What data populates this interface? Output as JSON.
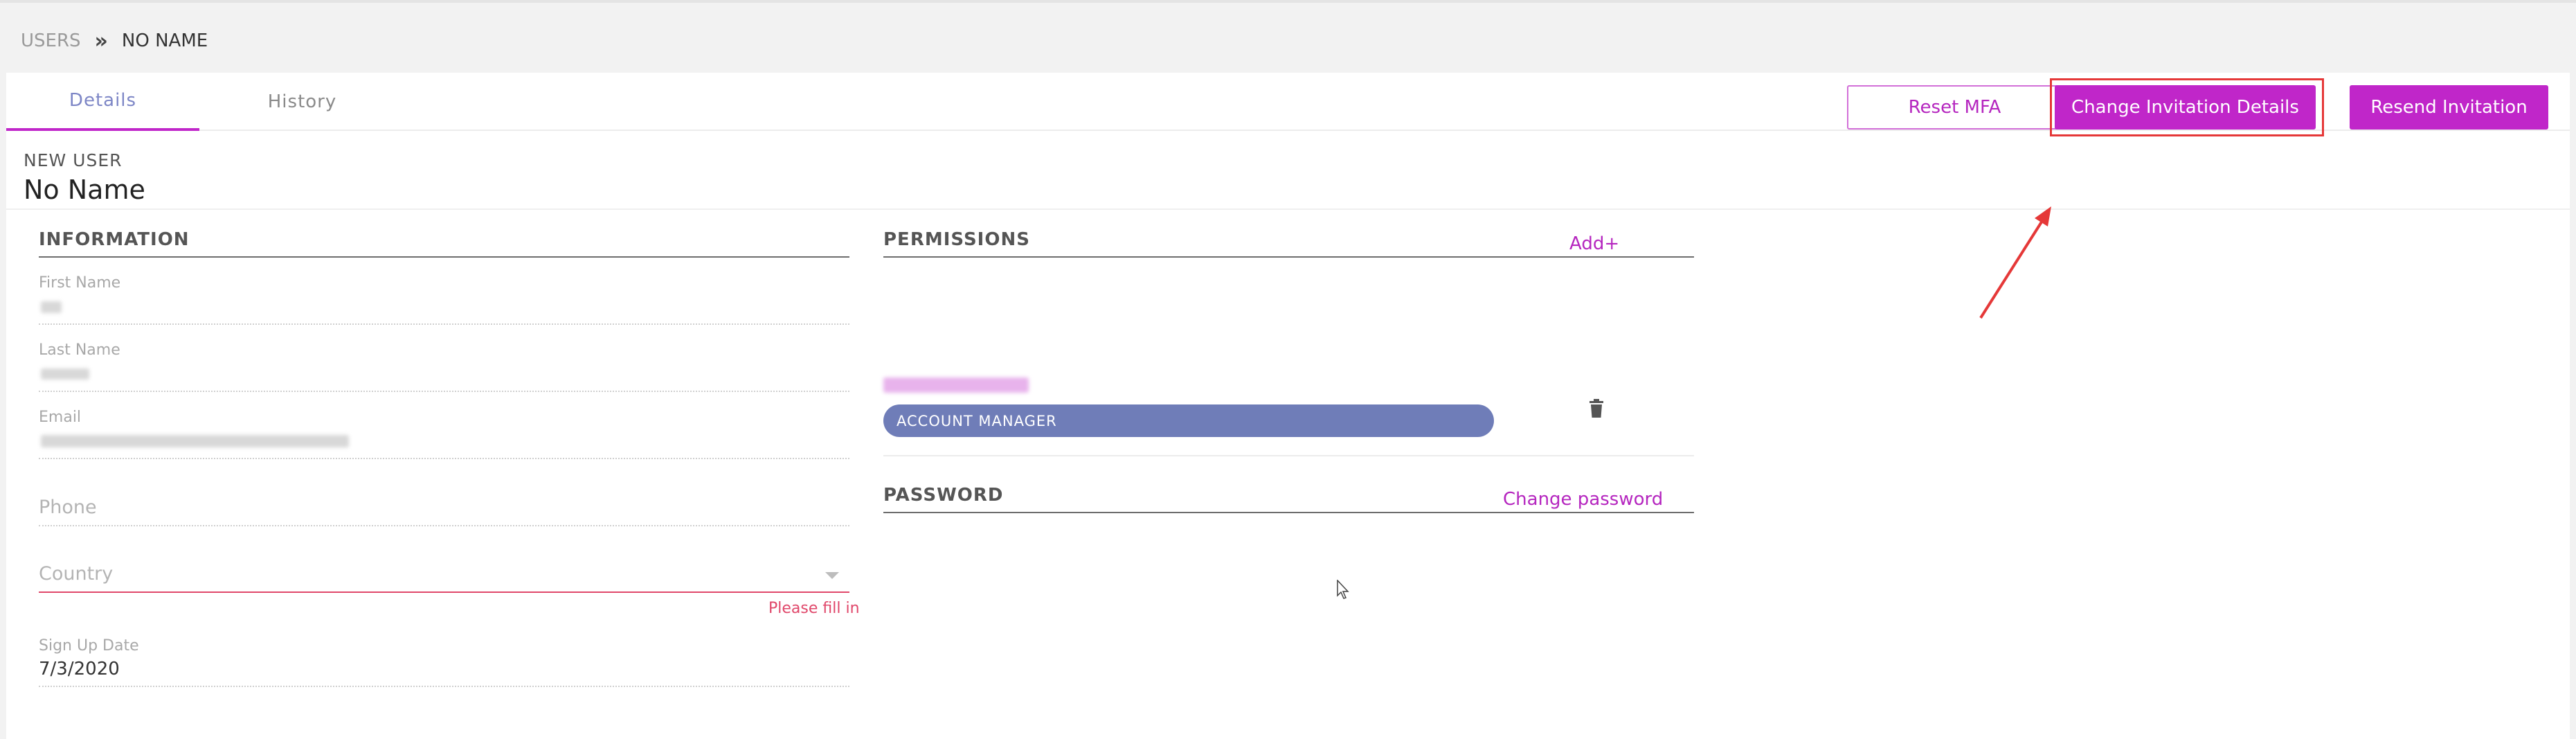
{
  "breadcrumb": {
    "root": "USERS",
    "separator": "»",
    "current": "NO NAME"
  },
  "tabs": [
    {
      "label": "Details",
      "active": true
    },
    {
      "label": "History",
      "active": false
    }
  ],
  "header": {
    "kicker": "NEW USER",
    "name": "No Name"
  },
  "actions": {
    "reset_mfa": "Reset MFA",
    "change_invitation": "Change Invitation Details",
    "resend_invitation": "Resend Invitation"
  },
  "information": {
    "title": "INFORMATION",
    "first_name_label": "First Name",
    "last_name_label": "Last Name",
    "email_label": "Email",
    "phone_placeholder": "Phone",
    "country_placeholder": "Country",
    "country_error": "Please fill in",
    "signup_label": "Sign Up Date",
    "signup_value": "7/3/2020"
  },
  "permissions": {
    "title": "PERMISSIONS",
    "add_link": "Add+",
    "role": "ACCOUNT MANAGER"
  },
  "password": {
    "title": "PASSWORD",
    "change_link": "Change password"
  },
  "colors": {
    "accent": "#c026c9",
    "tab_active_text": "#7d86c6",
    "role_pill": "#6f7db8",
    "error": "#e0476a",
    "annotation": "#e53838"
  }
}
